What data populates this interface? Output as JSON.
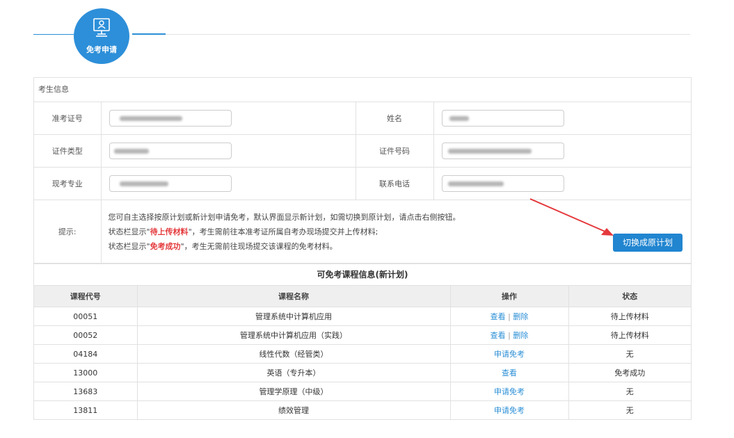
{
  "header": {
    "step_label": "免考申请",
    "step_icon": "monitor-user-icon"
  },
  "info_panel": {
    "title": "考生信息",
    "fields": {
      "admission_label": "准考证号",
      "name_label": "姓名",
      "id_type_label": "证件类型",
      "id_number_label": "证件号码",
      "major_label": "现考专业",
      "phone_label": "联系电话"
    },
    "tips_label": "提示:",
    "tips": {
      "line1": "您可自主选择按原计划或新计划申请免考，默认界面显示新计划，如需切换到原计划，请点击右侧按钮。",
      "line2_prefix": "状态栏显示\"",
      "line2_status": "待上传材料",
      "line2_suffix": "\"，考生需前往本准考证所属自考办现场提交并上传材料;",
      "line3_prefix": "状态栏显示\"",
      "line3_status": "免考成功",
      "line3_suffix": "\"，考生无需前往现场提交该课程的免考材料。"
    },
    "switch_button": "切换成原计划"
  },
  "courses": {
    "title": "可免考课程信息(新计划)",
    "headers": [
      "课程代号",
      "课程名称",
      "操作",
      "状态"
    ],
    "separator": "|",
    "rows": [
      {
        "code": "00051",
        "name": "管理系统中计算机应用",
        "action1": "查看",
        "action2": "删除",
        "status": "待上传材料"
      },
      {
        "code": "00052",
        "name": "管理系统中计算机应用（实践）",
        "action1": "查看",
        "action2": "删除",
        "status": "待上传材料"
      },
      {
        "code": "04184",
        "name": "线性代数（经管类）",
        "action1": "申请免考",
        "action2": "",
        "status": "无"
      },
      {
        "code": "13000",
        "name": "英语（专升本）",
        "action1": "查看",
        "action2": "",
        "status": "免考成功"
      },
      {
        "code": "13683",
        "name": "管理学原理（中级）",
        "action1": "申请免考",
        "action2": "",
        "status": "无"
      },
      {
        "code": "13811",
        "name": "绩效管理",
        "action1": "申请免考",
        "action2": "",
        "status": "无"
      }
    ]
  },
  "colors": {
    "accent": "#2d8fd9",
    "status_red": "#e4393c",
    "button": "#2185d0"
  }
}
